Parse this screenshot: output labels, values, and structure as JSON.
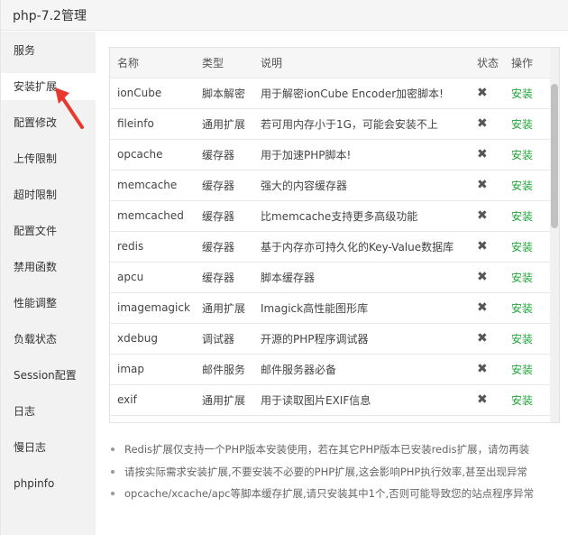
{
  "window": {
    "title": "php-7.2管理"
  },
  "sidebar": {
    "items": [
      {
        "label": "服务"
      },
      {
        "label": "安装扩展"
      },
      {
        "label": "配置修改"
      },
      {
        "label": "上传限制"
      },
      {
        "label": "超时限制"
      },
      {
        "label": "配置文件"
      },
      {
        "label": "禁用函数"
      },
      {
        "label": "性能调整"
      },
      {
        "label": "负载状态"
      },
      {
        "label": "Session配置"
      },
      {
        "label": "日志"
      },
      {
        "label": "慢日志"
      },
      {
        "label": "phpinfo"
      }
    ],
    "active_index": 1
  },
  "table": {
    "headers": {
      "name": "名称",
      "type": "类型",
      "desc": "说明",
      "status": "状态",
      "op": "操作"
    },
    "rows": [
      {
        "name": "ionCube",
        "type": "脚本解密",
        "desc": "用于解密ionCube Encoder加密脚本!",
        "status": "✖",
        "op": "安装"
      },
      {
        "name": "fileinfo",
        "type": "通用扩展",
        "desc": "若可用内存小于1G，可能会安装不上",
        "status": "✖",
        "op": "安装"
      },
      {
        "name": "opcache",
        "type": "缓存器",
        "desc": "用于加速PHP脚本!",
        "status": "✖",
        "op": "安装"
      },
      {
        "name": "memcache",
        "type": "缓存器",
        "desc": "强大的内容缓存器",
        "status": "✖",
        "op": "安装"
      },
      {
        "name": "memcached",
        "type": "缓存器",
        "desc": "比memcache支持更多高级功能",
        "status": "✖",
        "op": "安装"
      },
      {
        "name": "redis",
        "type": "缓存器",
        "desc": "基于内存亦可持久化的Key-Value数据库",
        "status": "✖",
        "op": "安装"
      },
      {
        "name": "apcu",
        "type": "缓存器",
        "desc": "脚本缓存器",
        "status": "✖",
        "op": "安装"
      },
      {
        "name": "imagemagick",
        "type": "通用扩展",
        "desc": "Imagick高性能图形库",
        "status": "✖",
        "op": "安装"
      },
      {
        "name": "xdebug",
        "type": "调试器",
        "desc": "开源的PHP程序调试器",
        "status": "✖",
        "op": "安装"
      },
      {
        "name": "imap",
        "type": "邮件服务",
        "desc": "邮件服务器必备",
        "status": "✖",
        "op": "安装"
      },
      {
        "name": "exif",
        "type": "通用扩展",
        "desc": "用于读取图片EXIF信息",
        "status": "✖",
        "op": "安装"
      }
    ]
  },
  "notes": [
    "Redis扩展仅支持一个PHP版本安装使用，若在其它PHP版本已安装redis扩展，请勿再装",
    "请按实际需求安装扩展,不要安装不必要的PHP扩展,这会影响PHP执行效率,甚至出现异常",
    "opcache/xcache/apc等脚本缓存扩展,请只安装其中1个,否则可能导致您的站点程序异常"
  ],
  "colors": {
    "install": "#20a53a",
    "annotation_arrow": "#e8392f"
  }
}
